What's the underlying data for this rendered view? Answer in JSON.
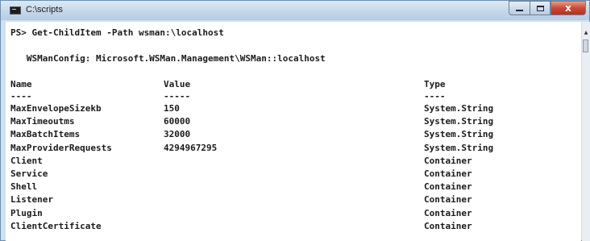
{
  "window": {
    "title": "C:\\scripts",
    "icon": "console-app-icon",
    "close_glyph": "x"
  },
  "console": {
    "command_line": "PS> Get-ChildItem -Path wsman:\\localhost",
    "container_header": "   WSManConfig: Microsoft.WSMan.Management\\WSMan::localhost",
    "columns": [
      "Name",
      "Value",
      "Type"
    ],
    "separators": [
      "----",
      "-----",
      "----"
    ],
    "rows": [
      {
        "name": "MaxEnvelopeSizekb",
        "value": "150",
        "type": "System.String"
      },
      {
        "name": "MaxTimeoutms",
        "value": "60000",
        "type": "System.String"
      },
      {
        "name": "MaxBatchItems",
        "value": "32000",
        "type": "System.String"
      },
      {
        "name": "MaxProviderRequests",
        "value": "4294967295",
        "type": "System.String"
      },
      {
        "name": "Client",
        "value": "",
        "type": "Container"
      },
      {
        "name": "Service",
        "value": "",
        "type": "Container"
      },
      {
        "name": "Shell",
        "value": "",
        "type": "Container"
      },
      {
        "name": "Listener",
        "value": "",
        "type": "Container"
      },
      {
        "name": "Plugin",
        "value": "",
        "type": "Container"
      },
      {
        "name": "ClientCertificate",
        "value": "",
        "type": "Container"
      }
    ]
  }
}
